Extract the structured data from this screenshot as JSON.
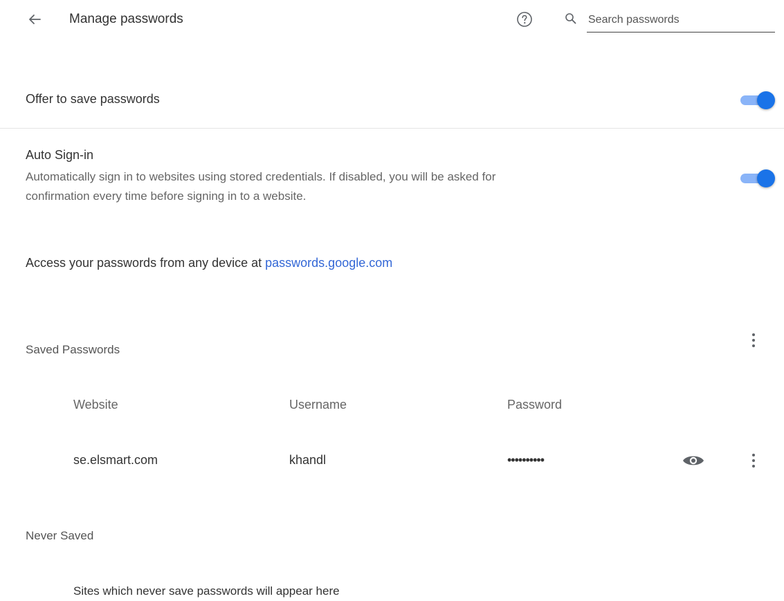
{
  "header": {
    "title": "Manage passwords",
    "back_icon": "arrow-back-icon",
    "help_icon": "help-circle-icon",
    "search_icon": "search-icon",
    "search_placeholder": "Search passwords",
    "search_value": ""
  },
  "settings": {
    "offer_to_save": {
      "label": "Offer to save passwords",
      "enabled": true
    },
    "auto_signin": {
      "label": "Auto Sign-in",
      "description_line1": "Automatically sign in to websites using stored credentials. If disabled, you will be asked for",
      "description_line2": "confirmation every time before signing in to a website.",
      "enabled": true
    },
    "access": {
      "prefix": "Access your passwords from any device at ",
      "link_text": "passwords.google.com"
    }
  },
  "saved_passwords": {
    "heading": "Saved Passwords",
    "more_icon": "more-vert-icon",
    "columns": {
      "website": "Website",
      "username": "Username",
      "password": "Password"
    },
    "rows": [
      {
        "website": "se.elsmart.com",
        "username": "khandl",
        "password": "••••••••••",
        "show_icon": "eye-icon",
        "more_icon": "more-vert-icon"
      }
    ]
  },
  "never_saved": {
    "heading": "Never Saved",
    "empty_message": "Sites which never save passwords will appear here"
  },
  "colors": {
    "accent": "#1a73e8",
    "toggle_track": "#8ab4f8",
    "link": "#3367d6",
    "icon": "#5f6368"
  }
}
